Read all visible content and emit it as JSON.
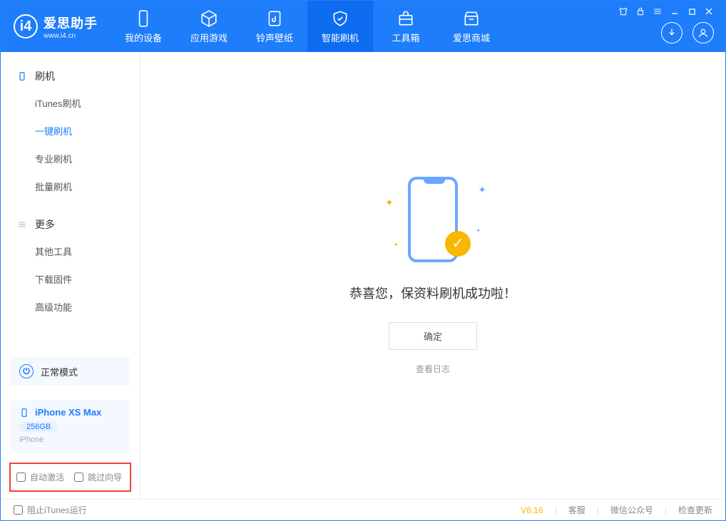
{
  "header": {
    "logo_title": "爱思助手",
    "logo_sub": "www.i4.cn",
    "tabs": [
      {
        "label": "我的设备"
      },
      {
        "label": "应用游戏"
      },
      {
        "label": "铃声壁纸"
      },
      {
        "label": "智能刷机"
      },
      {
        "label": "工具箱"
      },
      {
        "label": "爱思商城"
      }
    ]
  },
  "sidebar": {
    "section1_title": "刷机",
    "section1_items": [
      "iTunes刷机",
      "一键刷机",
      "专业刷机",
      "批量刷机"
    ],
    "section2_title": "更多",
    "section2_items": [
      "其他工具",
      "下载固件",
      "高级功能"
    ],
    "mode_label": "正常模式",
    "device_name": "iPhone XS Max",
    "device_capacity": "256GB",
    "device_type": "iPhone",
    "chk_auto_activate": "自动激活",
    "chk_skip_guide": "跳过向导"
  },
  "main": {
    "success_text": "恭喜您，保资料刷机成功啦！",
    "ok_button": "确定",
    "view_log": "查看日志"
  },
  "footer": {
    "block_itunes": "阻止iTunes运行",
    "version": "V8.16",
    "service": "客服",
    "wechat": "微信公众号",
    "check_update": "检查更新"
  }
}
